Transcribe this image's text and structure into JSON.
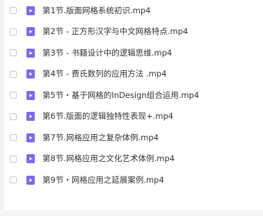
{
  "colors": {
    "icon_purple": "#7c69f0",
    "text": "#333333",
    "checkbox_border": "#c8c8c8"
  },
  "file_list": {
    "icon": "video-file-icon",
    "items": [
      {
        "name": "第1节.版面网格系统初识.mp4"
      },
      {
        "name": "第2节 - 正方形汉字与中文网格特点.mp4"
      },
      {
        "name": "第3节 - 书籍设计中的逻辑思维.mp4"
      },
      {
        "name": "第4节 - 费氏数列的应用方法 .mp4"
      },
      {
        "name": "第5节・基于网格的InDesign组合运用.mp4"
      },
      {
        "name": "第6节.版面的逻辑独特性表现+.mp4"
      },
      {
        "name": "第7节.网格应用之复杂体例.mp4"
      },
      {
        "name": "第8节.网格应用之文化艺术体例.mp4"
      },
      {
        "name": "第9节・网格应用之延展案例.mp4"
      }
    ]
  }
}
